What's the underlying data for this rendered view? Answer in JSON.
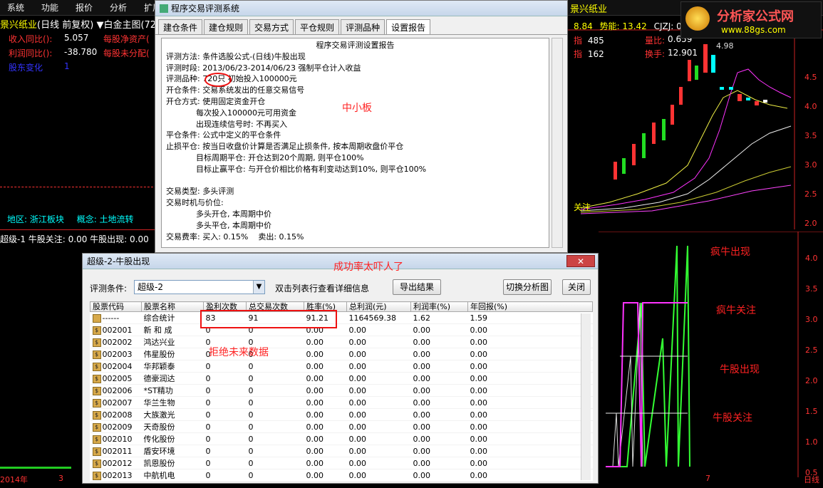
{
  "menubar": {
    "items": [
      "系统",
      "功能",
      "报价",
      "分析",
      "扩展"
    ]
  },
  "topbar": {
    "stock_title": "景兴纸业",
    "period": "(日线 前复权)",
    "main_chart": "白金主图(72)",
    "right_stock": "景兴纸业",
    "price_fragment": "8.84",
    "shili_label": "势能:",
    "shili_value": "13.42",
    "cjzj_label": "CJZJ:",
    "cjzj_value": "0.00"
  },
  "left_info": {
    "rows": [
      {
        "label": "收入同比():",
        "value": "5.057",
        "label2": "每股净资产("
      },
      {
        "label": "利润同比():",
        "value": "-38.780",
        "label2": "每股未分配("
      }
    ],
    "extra_label": "股东变化",
    "extra_value": "1",
    "region_label": "地区: 浙江板块",
    "concept_label": "概念: 土地流转",
    "bottom_line": "超级-1  牛股关注: 0.00  牛股出现: 0.00",
    "year": "2014年",
    "month3": "3",
    "month7": "7",
    "day_label": "日线"
  },
  "right_panel": {
    "rows": [
      {
        "label": "指",
        "value": "485",
        "label2": "量比:",
        "value2": "0.659"
      },
      {
        "label": "指",
        "value": "162",
        "label2": "换手:",
        "value2": "12.901"
      }
    ],
    "price_label": "4.98",
    "axis": [
      "4.5",
      "4.0",
      "3.5",
      "3.0",
      "2.5",
      "2.0"
    ],
    "lower_axis": [
      "4.0",
      "3.5",
      "3.0",
      "2.5",
      "2.0",
      "1.5",
      "1.0",
      "0.5"
    ],
    "attention_label": "关注",
    "watermark_title": "分析家公式网",
    "watermark_url": "www.88gs.com"
  },
  "dialog1": {
    "title": "程序交易评测系统",
    "tabs": [
      "建仓条件",
      "建仓规则",
      "交易方式",
      "平仓规则",
      "评测品种",
      "设置报告"
    ],
    "active_tab": 5,
    "report": {
      "heading": "程序交易评测设置报告",
      "lines": [
        "评测方法: 条件选股公式-(日线)牛股出现",
        "评测时段: 2013/06/23-2014/06/23 强制平仓计入收益",
        "评测品种: 720只 初始投入100000元",
        "开仓条件: 交易系统发出的任意交易信号",
        "开仓方式: 使用固定资金开仓",
        "            每次投入100000元可用资金",
        "            出现连续信号时: 不再买入",
        "平仓条件: 公式中定义的平仓条件",
        "止损平仓: 按当日收盘价计算是否满足止损条件, 按本周期收盘价平仓",
        "            目标周期平仓: 开仓达到20个周期, 则平仓100%",
        "            目标止赢平仓: 与开仓价相比价格有利变动达到10%, 则平仓100%",
        "",
        "交易类型: 多头评测",
        "交易时机与价位:",
        "            多头开仓, 本周期中价",
        "            多头平仓, 本周期中价",
        "交易费率: 买入: 0.15%    卖出: 0.15%"
      ]
    }
  },
  "dialog2": {
    "title": "超级-2-牛股出现",
    "close": "✕",
    "condition_label": "评测条件:",
    "condition_value": "超级-2",
    "hint": "双击列表行查看详细信息",
    "export_button": "导出结果",
    "switch_button": "切换分析图",
    "close_button": "关闭",
    "columns": [
      "股票代码",
      "股票名称",
      "盈利次数",
      "总交易次数",
      "胜率(%)",
      "总利润(元)",
      "利润率(%)",
      "年回报(%)"
    ],
    "rows": [
      [
        "------",
        "综合统计",
        "83",
        "91",
        "91.21",
        "1164569.38",
        "1.62",
        "1.59"
      ],
      [
        "002001",
        "新 和 成",
        "0",
        "0",
        "0.00",
        "0.00",
        "0.00",
        "0.00"
      ],
      [
        "002002",
        "鸿达兴业",
        "0",
        "0",
        "0.00",
        "0.00",
        "0.00",
        "0.00"
      ],
      [
        "002003",
        "伟星股份",
        "0",
        "0",
        "0.00",
        "0.00",
        "0.00",
        "0.00"
      ],
      [
        "002004",
        "华邦颖泰",
        "0",
        "0",
        "0.00",
        "0.00",
        "0.00",
        "0.00"
      ],
      [
        "002005",
        "德豪润达",
        "0",
        "0",
        "0.00",
        "0.00",
        "0.00",
        "0.00"
      ],
      [
        "002006",
        "*ST精功",
        "0",
        "0",
        "0.00",
        "0.00",
        "0.00",
        "0.00"
      ],
      [
        "002007",
        "华兰生物",
        "0",
        "0",
        "0.00",
        "0.00",
        "0.00",
        "0.00"
      ],
      [
        "002008",
        "大族激光",
        "0",
        "0",
        "0.00",
        "0.00",
        "0.00",
        "0.00"
      ],
      [
        "002009",
        "天奇股份",
        "0",
        "0",
        "0.00",
        "0.00",
        "0.00",
        "0.00"
      ],
      [
        "002010",
        "传化股份",
        "0",
        "0",
        "0.00",
        "0.00",
        "0.00",
        "0.00"
      ],
      [
        "002011",
        "盾安环境",
        "0",
        "0",
        "0.00",
        "0.00",
        "0.00",
        "0.00"
      ],
      [
        "002012",
        "凯恩股份",
        "0",
        "0",
        "0.00",
        "0.00",
        "0.00",
        "0.00"
      ],
      [
        "002013",
        "中航机电",
        "0",
        "0",
        "0.00",
        "0.00",
        "0.00",
        "0.00"
      ]
    ]
  },
  "annotations": {
    "small_board": "中小板",
    "success_rate": "成功率太吓人了",
    "no_future": "拒绝未来数据",
    "crazy_bull": "疯牛出现",
    "crazy_bull_watch": "疯牛关注",
    "bull_appear": "牛股出现",
    "bull_watch": "牛股关注"
  },
  "colors": {
    "accent_red": "#ff2222",
    "up": "#ff3333",
    "green": "#33ff33",
    "magenta": "#ff33ff"
  }
}
